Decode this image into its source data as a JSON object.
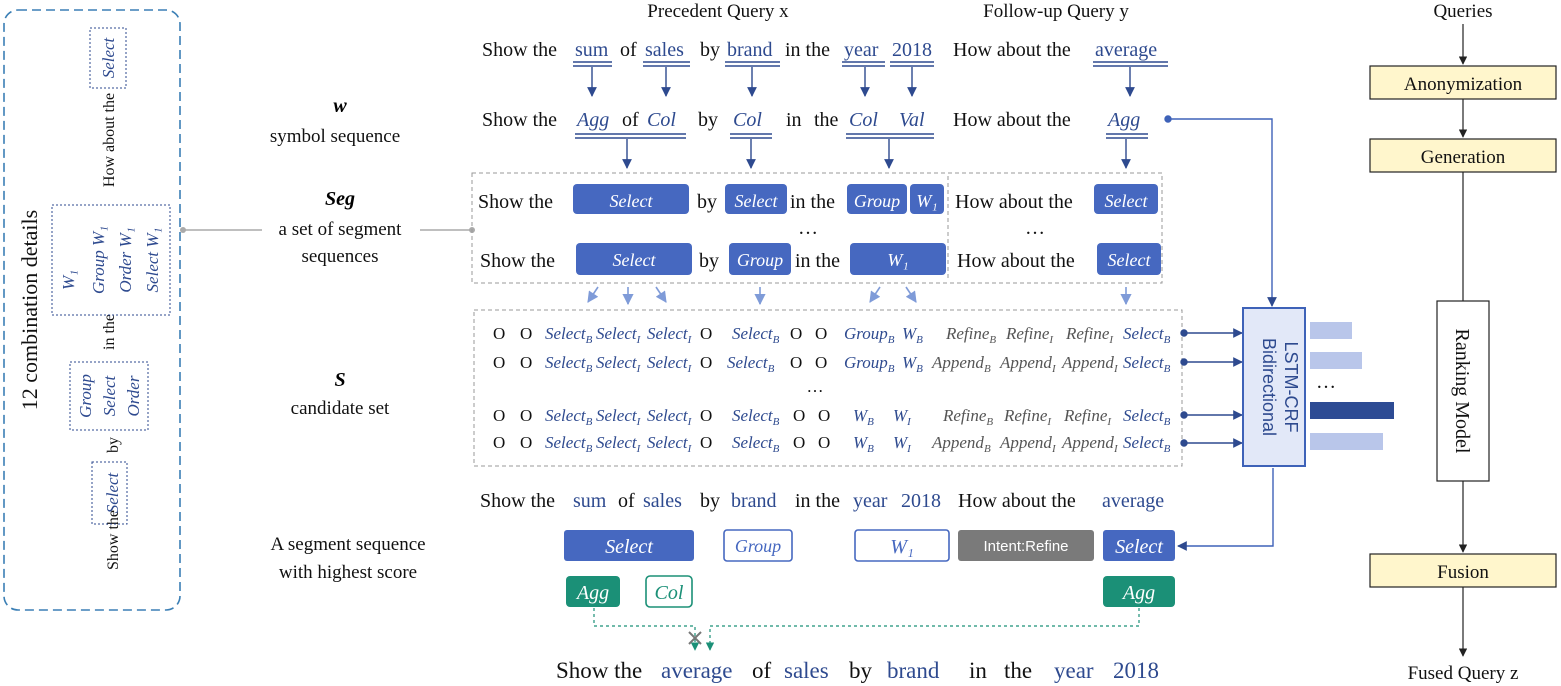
{
  "headers": {
    "precedent": "Precedent Query x",
    "followup": "Follow-up Query y",
    "queries": "Queries",
    "fused": "Fused Query z"
  },
  "labels": {
    "w_symbol": "w",
    "w_desc": "symbol sequence",
    "seg_symbol": "Seg",
    "seg_desc1": "a set of segment",
    "seg_desc2": "sequences",
    "s_symbol": "S",
    "s_desc": "candidate set",
    "best1": "A segment sequence",
    "best2": "with highest score"
  },
  "left_panel": {
    "title": "12 combination details",
    "show_the": "Show the",
    "by": "by",
    "in_the": "in the",
    "how_about": "How about the",
    "select": "Select",
    "group": "Group",
    "order": "Order",
    "w1": "W₁",
    "group_w1": "Group W₁",
    "order_w1": "Order W₁",
    "select_w1": "Select W₁"
  },
  "query": {
    "show_the": "Show the",
    "sum": "sum",
    "of": "of",
    "sales": "sales",
    "by": "by",
    "brand": "brand",
    "in_the": "in the",
    "year": "year",
    "y2018": "2018",
    "how_about": "How about the",
    "average": "average"
  },
  "symbols": {
    "agg": "Agg",
    "of": "of",
    "col": "Col",
    "by": "by",
    "in": "in",
    "the": "the",
    "val": "Val"
  },
  "segments": {
    "select": "Select",
    "group": "Group",
    "w1": "W₁",
    "ellipsis": "…"
  },
  "candidates": {
    "o": "O",
    "select_b": "Select_B",
    "select_i": "Select_I",
    "group_b": "Group_B",
    "w_b": "W_B",
    "w_i": "W_I",
    "refine_b": "Refine_B",
    "refine_i": "Refine_I",
    "append_b": "Append_B",
    "append_i": "Append_I",
    "ellipsis": "…"
  },
  "model": {
    "lstm1": "Bidirectional",
    "lstm2": "LSTM-CRF",
    "scores_ellipsis": "…",
    "anonymization": "Anonymization",
    "generation": "Generation",
    "ranking": "Ranking Model",
    "fusion": "Fusion"
  },
  "best": {
    "select": "Select",
    "group": "Group",
    "w1": "W₁",
    "intent": "Intent:Refine",
    "agg": "Agg",
    "col": "Col"
  },
  "fused_query": {
    "show_the": "Show the",
    "average": "average",
    "of": "of",
    "sales": "sales",
    "by": "by",
    "brand": "brand",
    "in": "in",
    "the": "the",
    "year": "year",
    "y2018": "2018"
  },
  "colors": {
    "blue": "#4668c0",
    "text_blue": "#2e4a8f",
    "green": "#1b9077",
    "grey": "#777777",
    "pale_yellow": "#fff6cc",
    "pale_blue": "#e2e8f8"
  }
}
